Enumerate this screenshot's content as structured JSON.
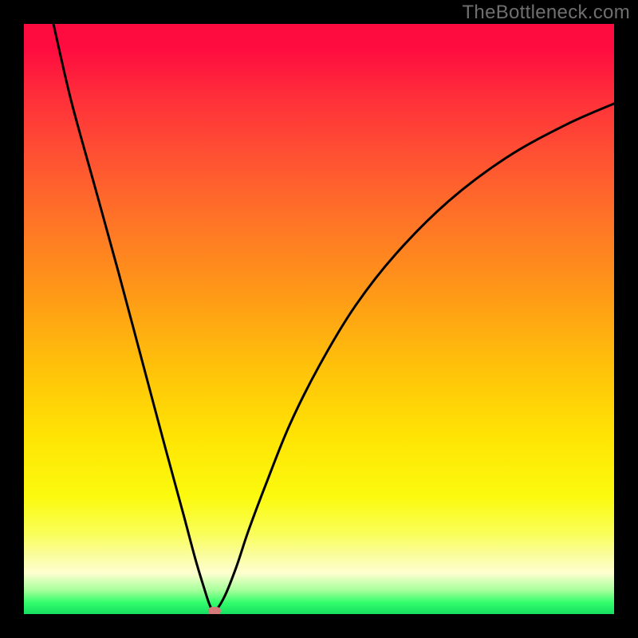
{
  "watermark": "TheBottleneck.com",
  "chart_data": {
    "type": "line",
    "title": "",
    "xlabel": "",
    "ylabel": "",
    "xlim": [
      0,
      100
    ],
    "ylim": [
      0,
      100
    ],
    "grid": false,
    "series": [
      {
        "name": "curve",
        "x": [
          5,
          8,
          12,
          16,
          20,
          24,
          27,
          29,
          30.5,
          31.5,
          32.3,
          34,
          36,
          38,
          41,
          45,
          50,
          56,
          63,
          72,
          82,
          92,
          100
        ],
        "y": [
          100,
          87,
          72.5,
          58,
          43,
          28,
          17,
          9.5,
          4.5,
          1.5,
          0.5,
          3,
          8,
          14,
          22,
          32,
          42,
          52,
          61,
          70,
          77.5,
          83,
          86.5
        ]
      }
    ],
    "marker": {
      "x": 32.3,
      "y": 0.5,
      "color": "#d57a79"
    },
    "background_gradient": {
      "top": "#fe0b40",
      "mid": "#ffe404",
      "bottom": "#16de62"
    },
    "frame_color": "#000000"
  }
}
